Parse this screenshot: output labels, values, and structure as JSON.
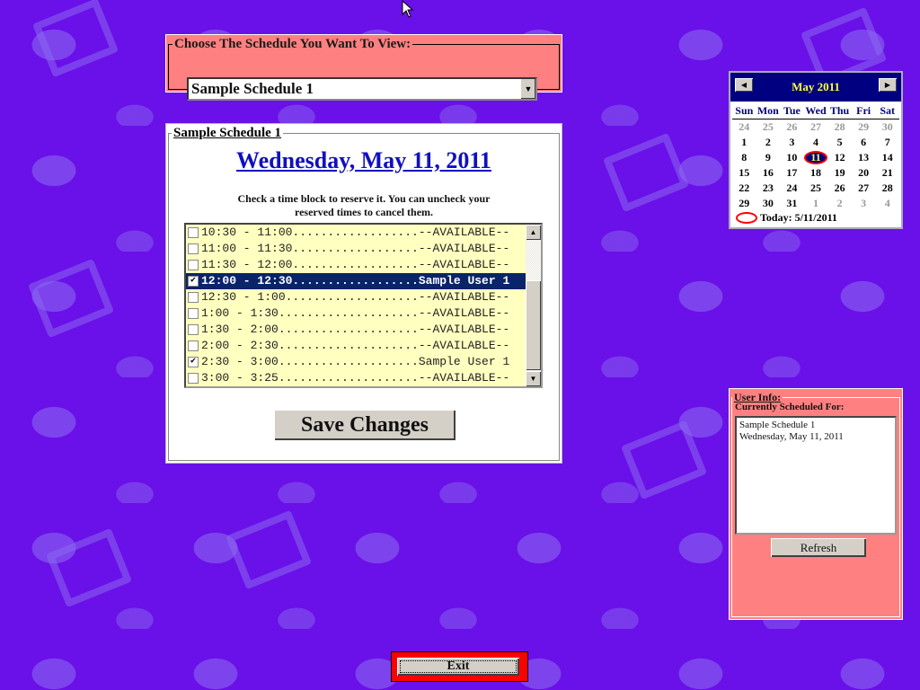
{
  "chooser": {
    "legend": "Choose The Schedule You Want To View:",
    "selected": "Sample Schedule 1"
  },
  "schedule": {
    "legend": "Sample Schedule 1",
    "date": "Wednesday, May 11, 2011",
    "instructions_line1": "Check a time block to reserve it. You can uncheck your",
    "instructions_line2": "reserved times to cancel them.",
    "slots": [
      {
        "label": "10:30 - 11:00..................--AVAILABLE--",
        "checked": false,
        "selected": false
      },
      {
        "label": "11:00 - 11:30..................--AVAILABLE--",
        "checked": false,
        "selected": false
      },
      {
        "label": "11:30 - 12:00..................--AVAILABLE--",
        "checked": false,
        "selected": false
      },
      {
        "label": "12:00 - 12:30..................Sample User 1",
        "checked": true,
        "selected": true
      },
      {
        "label": "12:30 - 1:00...................--AVAILABLE--",
        "checked": false,
        "selected": false
      },
      {
        "label": "1:00 - 1:30....................--AVAILABLE--",
        "checked": false,
        "selected": false
      },
      {
        "label": "1:30 - 2:00....................--AVAILABLE--",
        "checked": false,
        "selected": false
      },
      {
        "label": "2:00 - 2:30....................--AVAILABLE--",
        "checked": false,
        "selected": false
      },
      {
        "label": "2:30 - 3:00....................Sample User 1",
        "checked": true,
        "selected": false
      },
      {
        "label": "3:00 - 3:25....................--AVAILABLE--",
        "checked": false,
        "selected": false
      }
    ],
    "save_label": "Save Changes"
  },
  "calendar": {
    "title": "May 2011",
    "prev_icon": "left-arrow-icon",
    "next_icon": "right-arrow-icon",
    "days_of_week": [
      "Sun",
      "Mon",
      "Tue",
      "Wed",
      "Thu",
      "Fri",
      "Sat"
    ],
    "weeks": [
      [
        {
          "d": "24",
          "o": true
        },
        {
          "d": "25",
          "o": true
        },
        {
          "d": "26",
          "o": true
        },
        {
          "d": "27",
          "o": true
        },
        {
          "d": "28",
          "o": true
        },
        {
          "d": "29",
          "o": true
        },
        {
          "d": "30",
          "o": true
        }
      ],
      [
        {
          "d": "1"
        },
        {
          "d": "2"
        },
        {
          "d": "3"
        },
        {
          "d": "4"
        },
        {
          "d": "5"
        },
        {
          "d": "6"
        },
        {
          "d": "7"
        }
      ],
      [
        {
          "d": "8"
        },
        {
          "d": "9"
        },
        {
          "d": "10"
        },
        {
          "d": "11",
          "t": true
        },
        {
          "d": "12"
        },
        {
          "d": "13"
        },
        {
          "d": "14"
        }
      ],
      [
        {
          "d": "15"
        },
        {
          "d": "16"
        },
        {
          "d": "17"
        },
        {
          "d": "18"
        },
        {
          "d": "19"
        },
        {
          "d": "20"
        },
        {
          "d": "21"
        }
      ],
      [
        {
          "d": "22"
        },
        {
          "d": "23"
        },
        {
          "d": "24"
        },
        {
          "d": "25"
        },
        {
          "d": "26"
        },
        {
          "d": "27"
        },
        {
          "d": "28"
        }
      ],
      [
        {
          "d": "29"
        },
        {
          "d": "30"
        },
        {
          "d": "31"
        },
        {
          "d": "1",
          "o": true
        },
        {
          "d": "2",
          "o": true
        },
        {
          "d": "3",
          "o": true
        },
        {
          "d": "4",
          "o": true
        }
      ]
    ],
    "today_label": "Today: 5/11/2011"
  },
  "user_info": {
    "legend": "User Info:",
    "label": "Currently Scheduled For:",
    "line1": "Sample Schedule 1",
    "line2": "Wednesday, May 11, 2011",
    "refresh_label": "Refresh"
  },
  "exit_label": "Exit",
  "colors": {
    "background": "#6a10e8",
    "panel_pink": "#ff8080",
    "list_yellow": "#ffffc0",
    "selection": "#0a246a",
    "calendar_header": "#000080",
    "title_blue": "#1010c0"
  }
}
